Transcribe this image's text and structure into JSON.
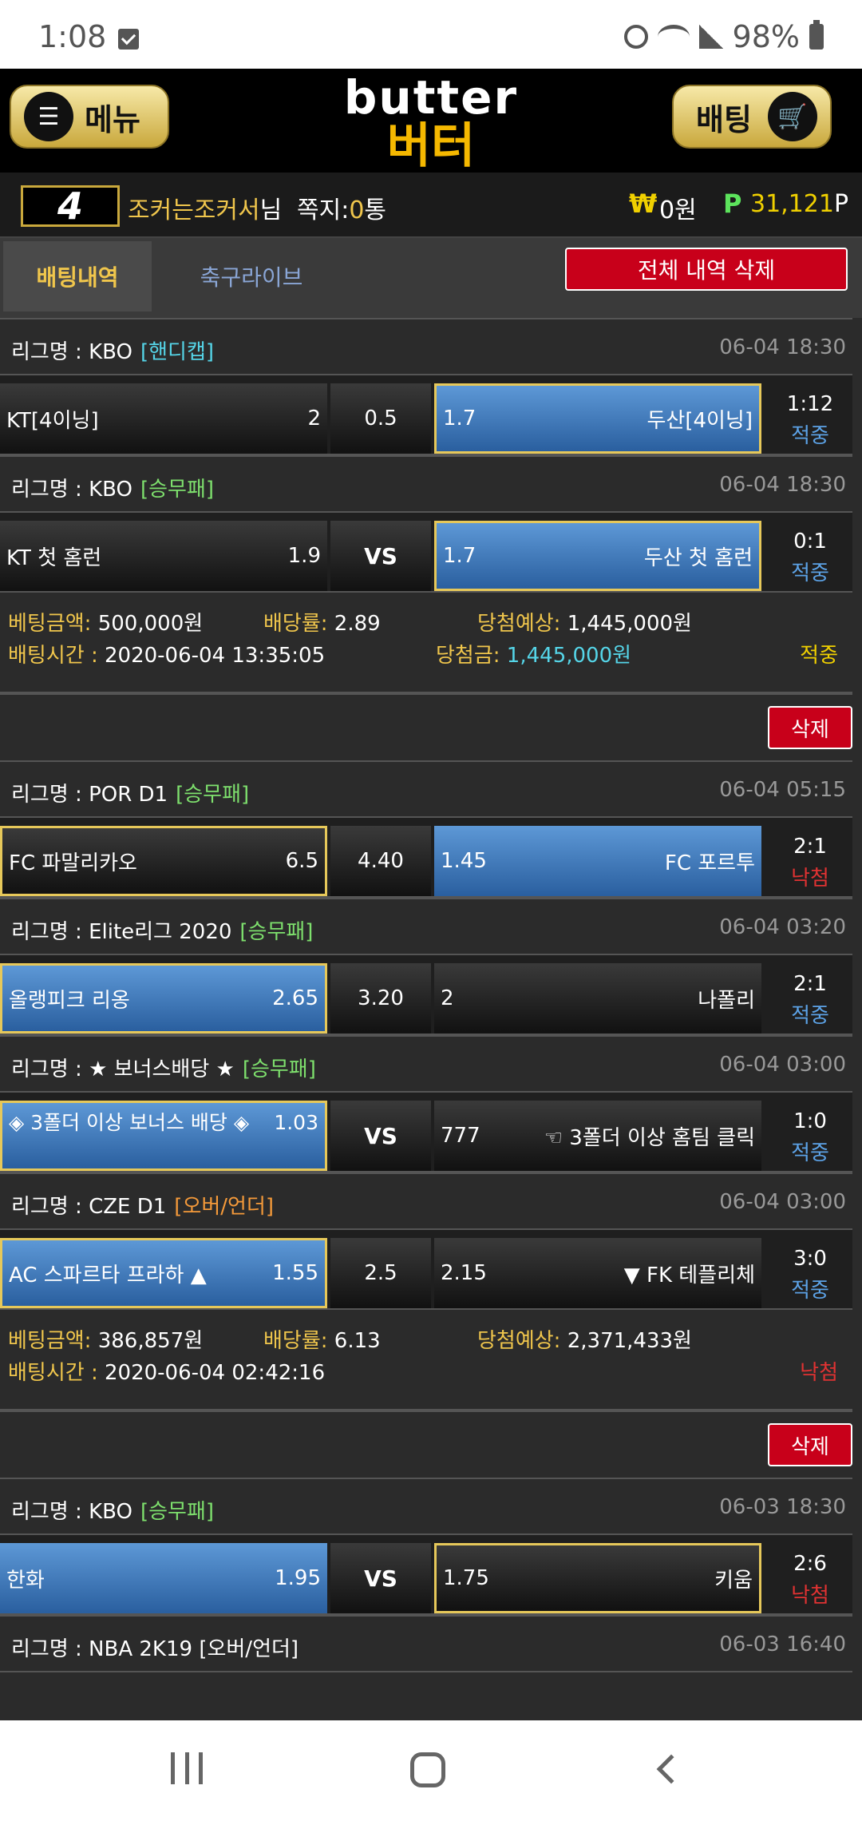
{
  "status_bar": {
    "time": "1:08",
    "battery": "98%"
  },
  "header": {
    "menu_label": "메뉴",
    "logo_en": "butter",
    "logo_ko": "버터",
    "bet_label": "배팅"
  },
  "user": {
    "level": "4",
    "name": "조커는조커서",
    "name_suffix": "님",
    "msg_label": "쪽지:",
    "msg_count": "0",
    "msg_unit": "통",
    "won_symbol": "₩",
    "won": "0원",
    "points_symbol": "P",
    "points": "31,121",
    "points_unit": "P"
  },
  "tabs": {
    "active": "배팅내역",
    "live": "축구라이브",
    "delete_all": "전체 내역 삭제"
  },
  "labels": {
    "league_prefix": "리그명 : ",
    "bet_amount": "베팅금액:",
    "odds": "배당률:",
    "expected": "당첨예상:",
    "bet_time": "배팅시간 : ",
    "win_amount": "당첨금:",
    "delete": "삭제"
  },
  "slip1": {
    "matches": [
      {
        "league": "KBO",
        "type": "[핸디캡]",
        "time": "06-04 18:30",
        "home": "KT[4이닝]",
        "home_odds": "2",
        "mid": "0.5",
        "away_odds": "1.7",
        "away": "두산[4이닝]",
        "score": "1:12",
        "result": "적중"
      },
      {
        "league": "KBO",
        "type": "[승무패]",
        "time": "06-04 18:30",
        "home": "KT 첫 홈런",
        "home_odds": "1.9",
        "mid": "VS",
        "away_odds": "1.7",
        "away": "두산 첫 홈런",
        "score": "0:1",
        "result": "적중"
      }
    ],
    "summary": {
      "bet_amount": "500,000원",
      "odds": "2.89",
      "expected": "1,445,000원",
      "bet_time": "2020-06-04 13:35:05",
      "win_amount": "1,445,000원",
      "status": "적중"
    }
  },
  "slip2": {
    "matches": [
      {
        "league": "POR D1",
        "type": "[승무패]",
        "time": "06-04 05:15",
        "home": "FC 파말리카오",
        "home_odds": "6.5",
        "mid": "4.40",
        "away_odds": "1.45",
        "away": "FC 포르투",
        "score": "2:1",
        "result": "낙첨"
      },
      {
        "league": "Elite리그 2020",
        "type": "[승무패]",
        "time": "06-04 03:20",
        "home": "올랭피크 리옹",
        "home_odds": "2.65",
        "mid": "3.20",
        "away_odds": "2",
        "away": "나폴리",
        "score": "2:1",
        "result": "적중"
      },
      {
        "league": "★ 보너스배당 ★",
        "type": "[승무패]",
        "time": "06-04 03:00",
        "home": "◈ 3폴더 이상 보너스 배당 ◈",
        "home_odds": "1.03",
        "mid": "VS",
        "away_odds": "777",
        "away": "☜ 3폴더 이상 홈팀 클릭",
        "score": "1:0",
        "result": "적중"
      },
      {
        "league": "CZE D1",
        "type": "[오버/언더]",
        "time": "06-04 03:00",
        "home": "AC 스파르타 프라하 ▲",
        "home_odds": "1.55",
        "mid": "2.5",
        "away_odds": "2.15",
        "away": "▼ FK 테플리체",
        "score": "3:0",
        "result": "적중"
      }
    ],
    "summary": {
      "bet_amount": "386,857원",
      "odds": "6.13",
      "expected": "2,371,433원",
      "bet_time": "2020-06-04 02:42:16",
      "status": "낙첨"
    }
  },
  "slip3": {
    "matches": [
      {
        "league": "KBO",
        "type": "[승무패]",
        "time": "06-03 18:30",
        "home": "한화",
        "home_odds": "1.95",
        "mid": "VS",
        "away_odds": "1.75",
        "away": "키움",
        "score": "2:6",
        "result": "낙첨"
      }
    ],
    "partial_league": "리그명 : NBA 2K19 [오버/언더]",
    "partial_time": "06-03 16:40"
  },
  "colors": {
    "accent_gold": "#f0c64c",
    "selected_blue": "#2a5f9f",
    "hit": "#5ca2e6",
    "miss": "#e03232",
    "delete_red": "#c8001a"
  }
}
